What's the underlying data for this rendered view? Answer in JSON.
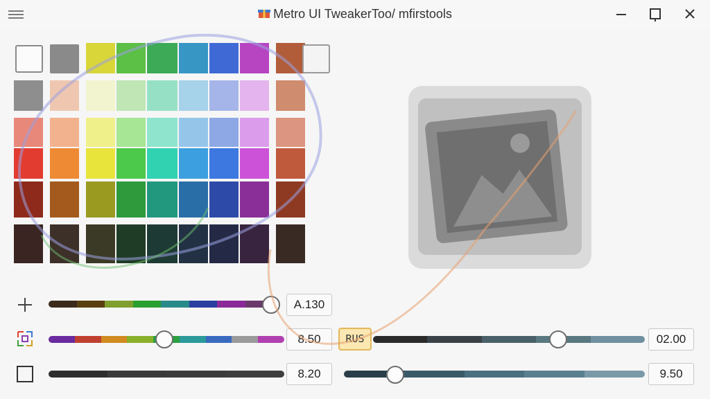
{
  "window": {
    "title": "Metro UI TweakerToo/ mfirstools",
    "icon": "gift-icon",
    "controls": [
      "minimize-icon",
      "maximize-icon",
      "close-icon"
    ]
  },
  "palette": {
    "rows": [
      [
        "#f7f7f7",
        "#8c8c8c",
        "#d9d63a",
        "#5cbf46",
        "#3daa58",
        "#3796c4",
        "#3f6ad6",
        "#b745c2",
        "#b25d3a",
        "#f4f4f4"
      ],
      [
        "#8e8e8e",
        "#efc7b0",
        "#f2f4cf",
        "#bfe6b4",
        "#96e1c6",
        "#a6d2ea",
        "#a5b5ea",
        "#e4b4ee",
        "#cf8c6e",
        "#cf8c6e"
      ],
      [
        "#e8887a",
        "#f2b28e",
        "#f0f08a",
        "#a6e694",
        "#8fe4cd",
        "#95c6ea",
        "#8ea8e6",
        "#dc9cec",
        "#dc9580",
        "#dc9580"
      ],
      [
        "#e23c30",
        "#ef8a34",
        "#e8e43c",
        "#4cc84a",
        "#30d2b2",
        "#3c9fe0",
        "#3c78e0",
        "#cc52d8",
        "#c05a3c",
        "#c05a3c"
      ],
      [
        "#8e2a1c",
        "#a45a1c",
        "#9a9a20",
        "#2f9a3c",
        "#22987e",
        "#2a6ea8",
        "#2e4aa8",
        "#8a2f98",
        "#8e3a22",
        "#8e3a22"
      ],
      [
        "#3a2522",
        "#3c3028",
        "#3a3a26",
        "#1f3c26",
        "#1e3a34",
        "#223244",
        "#242a46",
        "#38243e",
        "#3a2a24",
        "#3a2a24"
      ]
    ],
    "selected_swatch": "#f7f7f7",
    "right_swatch": "#f4f4f4"
  },
  "preview": {
    "icon": "image-icon"
  },
  "sliders": [
    {
      "id": "hue",
      "icon": "plus-icon",
      "colors": [
        "#3a2a1c",
        "#5a4010",
        "#7fa030",
        "#2aa030",
        "#2a8a8a",
        "#2a3ea0",
        "#8a2a98",
        "#6a3a6a"
      ],
      "position": 0.99,
      "value": "A.130"
    },
    {
      "id": "saturation",
      "icon": "rgb-grid-icon",
      "colors": [
        "#6a2aa0",
        "#c04030",
        "#d08a20",
        "#8ab02a",
        "#2aa040",
        "#2a9a9a",
        "#3a6ac0",
        "#9a9a9a",
        "#b040b0"
      ],
      "position": 0.49,
      "value": "8.50"
    },
    {
      "id": "brightness",
      "icon": "square-icon",
      "colors": [
        "#2e2e2e",
        "#3a3a3a",
        "#3c3c3c",
        "#3e3e3e"
      ],
      "position": null,
      "value": "8.20"
    },
    {
      "id": "accent-a",
      "colors": [
        "#2a2a2a",
        "#3a4248",
        "#4a6068",
        "#5a7880",
        "#7090a0"
      ],
      "position": 0.68,
      "value": "02.00"
    },
    {
      "id": "accent-b",
      "colors": [
        "#2a3e4a",
        "#3a5a68",
        "#4a7080",
        "#5a8090",
        "#7a9aa8"
      ],
      "position": 0.17,
      "value": "9.50"
    }
  ],
  "rgb_button": {
    "label": "RUS"
  }
}
